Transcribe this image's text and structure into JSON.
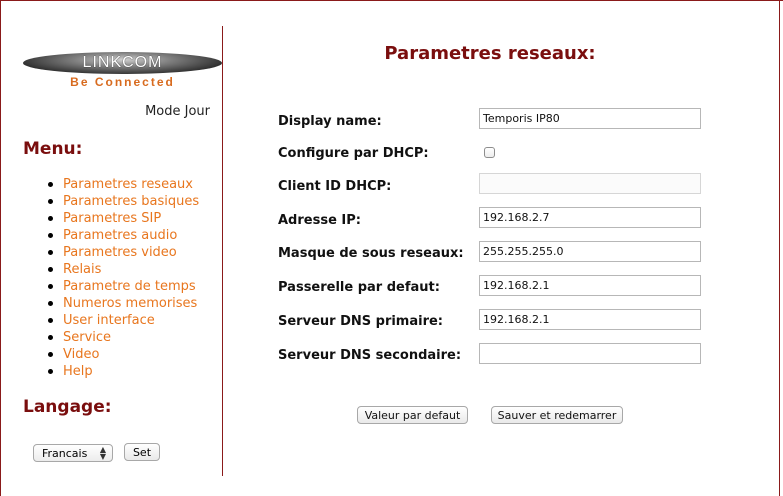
{
  "logo": {
    "name": "LINKCOM",
    "tagline": "Be Connected"
  },
  "mode_label": "Mode Jour",
  "menu": {
    "heading": "Menu:",
    "items": [
      "Parametres reseaux",
      "Parametres basiques",
      "Parametres SIP",
      "Parametres audio",
      "Parametres video",
      "Relais",
      "Parametre de temps",
      "Numeros memorises",
      "User interface",
      "Service",
      "Video",
      "Help"
    ]
  },
  "language": {
    "heading": "Langage:",
    "selected": "Francais",
    "set_label": "Set"
  },
  "page": {
    "title": "Parametres reseaux:"
  },
  "form": {
    "display_name": {
      "label": "Display name:",
      "value": "Temporis IP80"
    },
    "dhcp": {
      "label": "Configure par DHCP:",
      "checked": false
    },
    "client_id": {
      "label": "Client ID DHCP:",
      "value": ""
    },
    "ip": {
      "label": "Adresse IP:",
      "value": "192.168.2.7"
    },
    "mask": {
      "label": "Masque de sous reseaux:",
      "value": "255.255.255.0"
    },
    "gateway": {
      "label": "Passerelle par defaut:",
      "value": "192.168.2.1"
    },
    "dns1": {
      "label": "Serveur DNS primaire:",
      "value": "192.168.2.1"
    },
    "dns2": {
      "label": "Serveur DNS secondaire:",
      "value": ""
    }
  },
  "buttons": {
    "defaults": "Valeur par defaut",
    "save": "Sauver et redemarrer"
  },
  "colors": {
    "heading": "#7a0e0e",
    "link": "#e8761e",
    "divider": "#8b1a1a",
    "tagline": "#d86b1f"
  }
}
